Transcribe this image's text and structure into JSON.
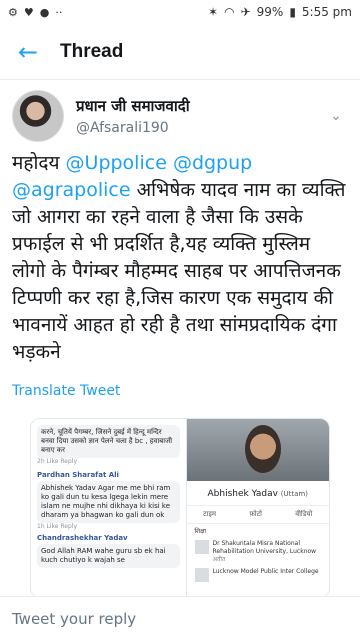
{
  "status_bar": {
    "left_icons": [
      "settings-icon",
      "heart-icon",
      "messages-icon",
      "more-dots-icon"
    ],
    "right_icons": [
      "vibrate-icon",
      "wifi-icon",
      "airplane-icon",
      "battery-icon"
    ],
    "battery": "99%",
    "time": "5:55 pm"
  },
  "appbar": {
    "title": "Thread"
  },
  "author": {
    "display_name": "प्रधान जी समाजवादी",
    "handle": "@Afsarali190"
  },
  "tweet": {
    "parts": [
      "महोदय ",
      "@Uppolice",
      " ",
      "@dgpup",
      " ",
      "@agrapolice",
      " अभिषेक यादव नाम का व्यक्ति जो आगरा का रहने वाला है जैसा कि उसके प्रफाईल से भी प्रदर्शित है,यह व्यक्ति मुस्लिम लोगो के पैगंम्बर मौहम्मद साहब पर आपत्तिजनक टिप्पणी कर रहा है,जिस कारण एक समुदाय की भावनायें आहत हो रही है तथा सांमप्रदायिक दंगा भड़कने"
    ],
    "translate_label": "Translate Tweet"
  },
  "media": {
    "left_panel": {
      "top_bubble": "करने, चूतियें पैगम्बर, जिसने दुबई में हिन्दू मन्दिर बनवा दिया उसको ज्ञान पेलने चला है bc , हवाबाजी बनाए कर",
      "top_meta": "2h  Like  Reply",
      "comments": [
        {
          "name": "Pardhan Sharafat Ali",
          "text": "Abhishek Yadav Agar me me bhi ram ko gali dun tu kesa lgega lekin mere islam ne mujhe nhi dikhaya ki kisi ke dharam ya bhagwan ko gali dun ok",
          "meta": "1h  Like  Reply"
        },
        {
          "name": "Chandrashekhar Yadav",
          "text": "God Allah  RAM wahe guru sb ek hai kuch chutiyo k wajah se"
        }
      ]
    },
    "right_panel": {
      "profile_name": "Abhishek Yadav",
      "profile_sub": "(Uttam)",
      "tabs": [
        "टाइम",
        "फ़ोटो",
        "वीडियो"
      ],
      "edu_heading": "शिक्षा",
      "edu_items": [
        "Dr Shakuntala Misra National Rehabilitation University, Lucknow",
        "Lucknow Model Public Inter College"
      ],
      "edu_sub": "अतीत"
    }
  },
  "reply_bar": {
    "placeholder": "Tweet your reply"
  }
}
